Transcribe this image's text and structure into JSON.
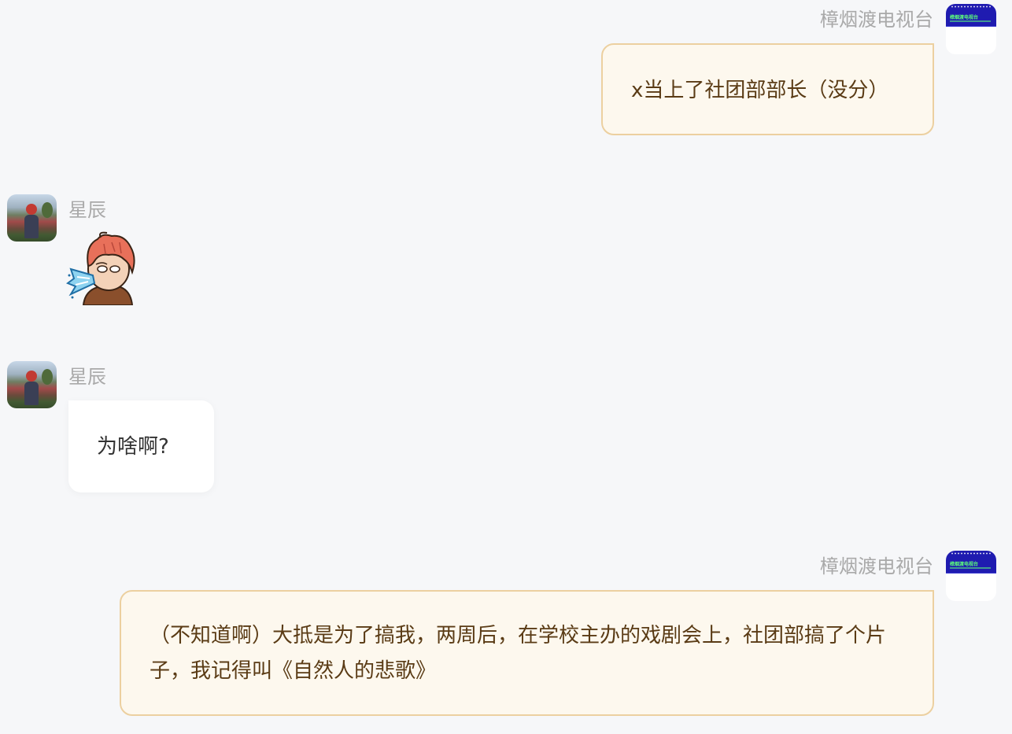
{
  "messages": [
    {
      "sender": "樟烟渡电视台",
      "text": "x当上了社团部部长（没分）"
    },
    {
      "sender": "星辰",
      "sticker": "sneezing-boy-sticker"
    },
    {
      "sender": "星辰",
      "text": "为啥啊?"
    },
    {
      "sender": "樟烟渡电视台",
      "text": "（不知道啊）大抵是为了搞我，两周后，在学校主办的戏剧会上，社团部搞了个片子，我记得叫《自然人的悲歌》"
    }
  ],
  "avatars": {
    "tv_caption": "樟烟渡电视台"
  },
  "colors": {
    "background": "#f6f7f9",
    "my_bubble": "#fdf8ee",
    "my_bubble_border": "#ecd0a0",
    "my_text": "#5a3b15",
    "their_bubble": "#ffffff",
    "their_text": "#333333",
    "name_text": "#a9a9a9",
    "tv_blue": "#1f1bb0"
  }
}
